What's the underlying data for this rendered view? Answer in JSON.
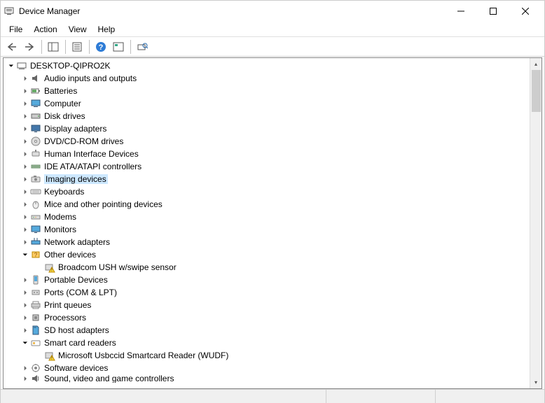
{
  "window": {
    "title": "Device Manager"
  },
  "menu": {
    "file": "File",
    "action": "Action",
    "view": "View",
    "help": "Help"
  },
  "tree": {
    "root": "DESKTOP-QIPRO2K",
    "categories": [
      {
        "label": "Audio inputs and outputs",
        "expanded": false,
        "icon": "audio"
      },
      {
        "label": "Batteries",
        "expanded": false,
        "icon": "battery"
      },
      {
        "label": "Computer",
        "expanded": false,
        "icon": "computer"
      },
      {
        "label": "Disk drives",
        "expanded": false,
        "icon": "disk"
      },
      {
        "label": "Display adapters",
        "expanded": false,
        "icon": "display"
      },
      {
        "label": "DVD/CD-ROM drives",
        "expanded": false,
        "icon": "dvd"
      },
      {
        "label": "Human Interface Devices",
        "expanded": false,
        "icon": "hid"
      },
      {
        "label": "IDE ATA/ATAPI controllers",
        "expanded": false,
        "icon": "ide"
      },
      {
        "label": "Imaging devices",
        "expanded": false,
        "icon": "imaging",
        "selected": true
      },
      {
        "label": "Keyboards",
        "expanded": false,
        "icon": "keyboard"
      },
      {
        "label": "Mice and other pointing devices",
        "expanded": false,
        "icon": "mouse"
      },
      {
        "label": "Modems",
        "expanded": false,
        "icon": "modem"
      },
      {
        "label": "Monitors",
        "expanded": false,
        "icon": "monitor"
      },
      {
        "label": "Network adapters",
        "expanded": false,
        "icon": "network"
      },
      {
        "label": "Other devices",
        "expanded": true,
        "icon": "other",
        "children": [
          {
            "label": "Broadcom USH w/swipe sensor",
            "icon": "warn"
          }
        ]
      },
      {
        "label": "Portable Devices",
        "expanded": false,
        "icon": "portable"
      },
      {
        "label": "Ports (COM & LPT)",
        "expanded": false,
        "icon": "ports"
      },
      {
        "label": "Print queues",
        "expanded": false,
        "icon": "printer"
      },
      {
        "label": "Processors",
        "expanded": false,
        "icon": "cpu"
      },
      {
        "label": "SD host adapters",
        "expanded": false,
        "icon": "sd"
      },
      {
        "label": "Smart card readers",
        "expanded": true,
        "icon": "smartcard",
        "children": [
          {
            "label": "Microsoft Usbccid Smartcard Reader (WUDF)",
            "icon": "warn"
          }
        ]
      },
      {
        "label": "Software devices",
        "expanded": false,
        "icon": "software"
      },
      {
        "label": "Sound, video and game controllers",
        "expanded": false,
        "icon": "sound",
        "cut": true
      }
    ]
  }
}
